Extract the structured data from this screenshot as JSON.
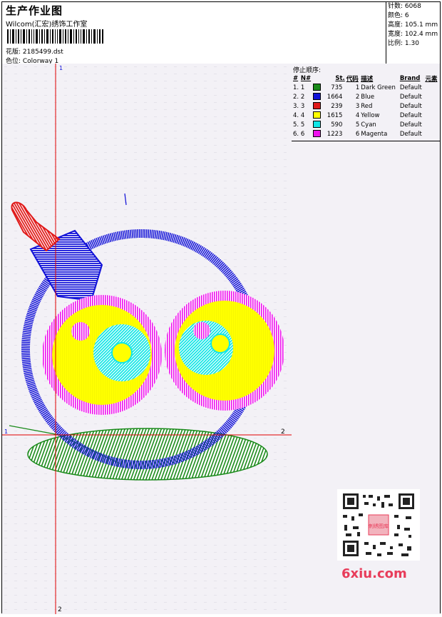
{
  "header": {
    "title": "生产作业图",
    "software": "Wilcom(汇宏)绣饰工作室",
    "design_label": "花版: 2185499.dst",
    "colorway_label": "色位: Colorway 1"
  },
  "stats": [
    {
      "label": "针数:",
      "value": "6068"
    },
    {
      "label": "颜色:",
      "value": "6"
    },
    {
      "label": "高度:",
      "value": "105.1 mm"
    },
    {
      "label": "宽度:",
      "value": "102.4 mm"
    },
    {
      "label": "比例:",
      "value": "1.30"
    }
  ],
  "stop_sequence": {
    "title": "停止顺序:",
    "columns": [
      "#",
      "N#",
      "St.",
      "代码",
      "描述",
      "Brand",
      "元素"
    ],
    "rows": [
      {
        "idx": "1.",
        "n": "1",
        "color": "#1a8a1a",
        "st": "735",
        "code": "1",
        "desc": "Dark Green",
        "brand": "Default"
      },
      {
        "idx": "2.",
        "n": "2",
        "color": "#1212d8",
        "st": "1664",
        "code": "2",
        "desc": "Blue",
        "brand": "Default"
      },
      {
        "idx": "3.",
        "n": "3",
        "color": "#e01a1a",
        "st": "239",
        "code": "3",
        "desc": "Red",
        "brand": "Default"
      },
      {
        "idx": "4.",
        "n": "4",
        "color": "#ffff00",
        "st": "1615",
        "code": "4",
        "desc": "Yellow",
        "brand": "Default"
      },
      {
        "idx": "5.",
        "n": "5",
        "color": "#11e6e6",
        "st": "590",
        "code": "5",
        "desc": "Cyan",
        "brand": "Default"
      },
      {
        "idx": "6.",
        "n": "6",
        "color": "#ee11ee",
        "st": "1223",
        "code": "6",
        "desc": "Magenta",
        "brand": "Default"
      }
    ]
  },
  "guides": {
    "v_top": "1",
    "v_bottom": "2",
    "h_left": "1",
    "h_right": "2"
  },
  "watermark": {
    "logo_text": "6xiu.com",
    "qr_badge": "刺绣图库"
  },
  "colors": {
    "guide": "#e00000",
    "green": "#1a8a1a",
    "blue": "#1212d8",
    "red": "#e01a1a",
    "yellow": "#ffff00",
    "cyan": "#11e6e6",
    "magenta": "#ee11ee"
  }
}
